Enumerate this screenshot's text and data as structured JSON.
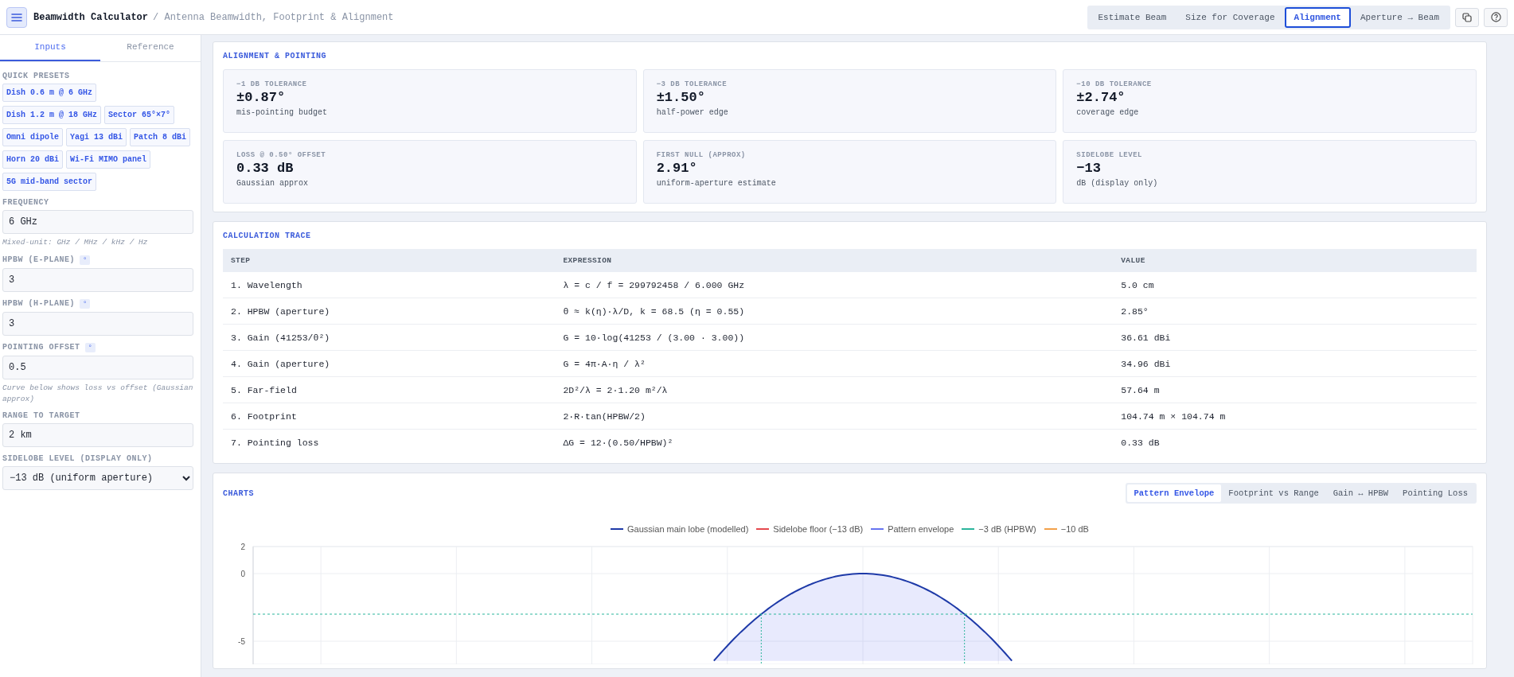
{
  "header": {
    "title": "Beamwidth Calculator",
    "subtitle": "/ Antenna Beamwidth, Footprint & Alignment",
    "modes": [
      {
        "label": "Estimate Beam",
        "selected": false
      },
      {
        "label": "Size for Coverage",
        "selected": false
      },
      {
        "label": "Alignment",
        "selected": true
      },
      {
        "label": "Aperture → Beam",
        "selected": false
      }
    ]
  },
  "sidebar": {
    "tabs": [
      {
        "label": "Inputs",
        "selected": true
      },
      {
        "label": "Reference",
        "selected": false
      }
    ],
    "presets_label": "QUICK PRESETS",
    "presets": [
      "Dish 0.6 m @ 6 GHz",
      "Dish 1.2 m @ 18 GHz",
      "Sector 65°×7°",
      "Omni dipole",
      "Yagi 13 dBi",
      "Patch 8 dBi",
      "Horn 20 dBi",
      "Wi-Fi MIMO panel",
      "5G mid-band sector"
    ],
    "fields": [
      {
        "kind": "input",
        "label": "FREQUENCY",
        "value": "6 GHz",
        "hint": "Mixed-unit: GHz / MHz / kHz / Hz"
      },
      {
        "kind": "input",
        "label": "HPBW (E-PLANE)",
        "unit": "°",
        "value": "3"
      },
      {
        "kind": "input",
        "label": "HPBW (H-PLANE)",
        "unit": "°",
        "value": "3"
      },
      {
        "kind": "input",
        "label": "POINTING OFFSET",
        "unit": "°",
        "value": "0.5",
        "hint": "Curve below shows loss vs offset (Gaussian approx)"
      },
      {
        "kind": "input",
        "label": "RANGE TO TARGET",
        "value": "2 km"
      },
      {
        "kind": "select",
        "label": "SIDELOBE LEVEL (DISPLAY ONLY)",
        "value": "−13 dB (uniform aperture)"
      }
    ]
  },
  "alignment": {
    "title": "ALIGNMENT & POINTING",
    "stats": [
      {
        "label": "−1 DB TOLERANCE",
        "value": "±0.87°",
        "note": "mis-pointing budget"
      },
      {
        "label": "−3 DB TOLERANCE",
        "value": "±1.50°",
        "note": "half-power edge"
      },
      {
        "label": "−10 DB TOLERANCE",
        "value": "±2.74°",
        "note": "coverage edge"
      },
      {
        "label": "LOSS @ 0.50° OFFSET",
        "value": "0.33 dB",
        "note": "Gaussian approx"
      },
      {
        "label": "FIRST NULL (APPROX)",
        "value": "2.91°",
        "note": "uniform-aperture estimate"
      },
      {
        "label": "SIDELOBE LEVEL",
        "value": "−13",
        "note": "dB (display only)"
      }
    ]
  },
  "trace": {
    "title": "CALCULATION TRACE",
    "columns": [
      "STEP",
      "EXPRESSION",
      "VALUE"
    ],
    "rows": [
      [
        "1. Wavelength",
        "λ = c / f = 299792458 / 6.000 GHz",
        "5.0 cm"
      ],
      [
        "2. HPBW (aperture)",
        "θ ≈ k(η)·λ/D, k = 68.5 (η = 0.55)",
        "2.85°"
      ],
      [
        "3. Gain (41253/θ²)",
        "G = 10·log(41253 / (3.00 · 3.00))",
        "36.61 dBi"
      ],
      [
        "4. Gain (aperture)",
        "G = 4π·A·η / λ²",
        "34.96 dBi"
      ],
      [
        "5. Far-field",
        "2D²/λ = 2·1.20 m²/λ",
        "57.64 m"
      ],
      [
        "6. Footprint",
        "2·R·tan(HPBW/2)",
        "104.74 m × 104.74 m"
      ],
      [
        "7. Pointing loss",
        "ΔG = 12·(0.50/HPBW)²",
        "0.33 dB"
      ]
    ]
  },
  "charts": {
    "title": "CHARTS",
    "tabs": [
      {
        "label": "Pattern Envelope",
        "selected": true
      },
      {
        "label": "Footprint vs Range",
        "selected": false
      },
      {
        "label": "Gain ↔ HPBW",
        "selected": false
      },
      {
        "label": "Pointing Loss",
        "selected": false
      }
    ],
    "legend": [
      {
        "name": "Gaussian main lobe (modelled)",
        "color": "#1e3aa8"
      },
      {
        "name": "Sidelobe floor (−13 dB)",
        "color": "#e5484d"
      },
      {
        "name": "Pattern envelope",
        "color": "#6674f0"
      },
      {
        "name": "−3 dB (HPBW)",
        "color": "#2bb59c"
      },
      {
        "name": "−10 dB",
        "color": "#f2a14a"
      }
    ],
    "y_axis_labels": [
      "2",
      "0",
      "-5"
    ]
  }
}
